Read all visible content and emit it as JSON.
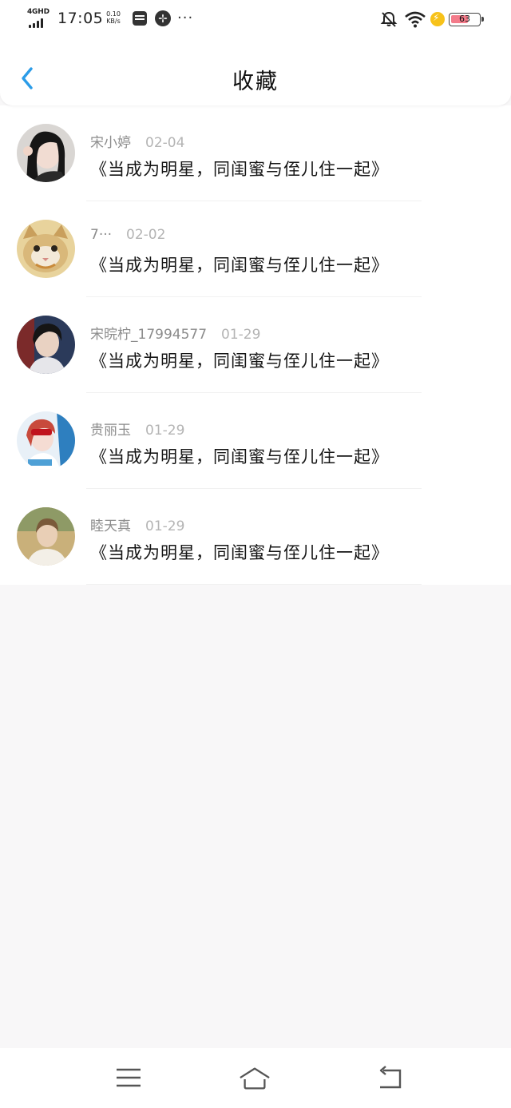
{
  "status_bar": {
    "network": "4GHD",
    "time": "17:05",
    "speed_value": "0.10",
    "speed_unit": "KB/s",
    "more": "···",
    "battery_level": "63",
    "battery_fraction": 0.63
  },
  "header": {
    "title": "收藏",
    "accent_color": "#2b9ce8"
  },
  "favorites": [
    {
      "user": "宋小婷",
      "date": "02-04",
      "title": "《当成为明星，同闺蜜与侄儿住一起》"
    },
    {
      "user": "7···",
      "date": "02-02",
      "title": "《当成为明星，同闺蜜与侄儿住一起》"
    },
    {
      "user": "宋晥柠_17994577",
      "date": "01-29",
      "title": "《当成为明星，同闺蜜与侄儿住一起》"
    },
    {
      "user": "贵丽玉",
      "date": "01-29",
      "title": "《当成为明星，同闺蜜与侄儿住一起》"
    },
    {
      "user": "睦天真",
      "date": "01-29",
      "title": "《当成为明星，同闺蜜与侄儿住一起》"
    }
  ],
  "icons": {
    "back": "chevron-left-icon",
    "menu": "hamburger-menu-icon",
    "home": "home-icon",
    "return": "return-arrow-icon"
  }
}
